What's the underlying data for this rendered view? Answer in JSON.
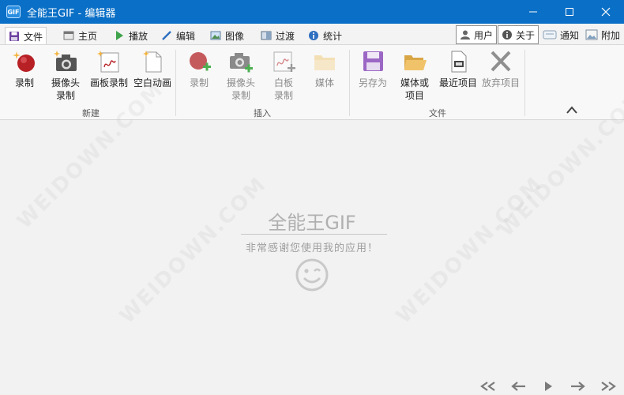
{
  "window": {
    "app_icon_text": "GIF",
    "title": "全能王GIF - 编辑器"
  },
  "tabs": [
    {
      "label": "文件",
      "icon": "save-icon",
      "active": true
    },
    {
      "label": "主页",
      "icon": "home-icon"
    },
    {
      "label": "播放",
      "icon": "play-icon"
    },
    {
      "label": "编辑",
      "icon": "pencil-icon"
    },
    {
      "label": "图像",
      "icon": "image-icon"
    },
    {
      "label": "过渡",
      "icon": "transition-icon"
    },
    {
      "label": "统计",
      "icon": "info-icon"
    }
  ],
  "right_buttons": {
    "user": "用户",
    "about": "关于",
    "notify": "通知",
    "attach": "附加"
  },
  "ribbon": {
    "groups": {
      "new": "新建",
      "insert": "插入",
      "file": "文件"
    },
    "new_items": [
      {
        "label": "录制",
        "icon": "record-icon"
      },
      {
        "label": "摄像头\n录制",
        "icon": "camera-icon"
      },
      {
        "label": "画板录制",
        "icon": "board-icon"
      },
      {
        "label": "空白动画",
        "icon": "blank-page-icon"
      }
    ],
    "insert_items": [
      {
        "label": "录制",
        "icon": "record-add-icon"
      },
      {
        "label": "摄像头\n录制",
        "icon": "camera-add-icon"
      },
      {
        "label": "白板\n录制",
        "icon": "board-add-icon"
      },
      {
        "label": "媒体",
        "icon": "folder-icon"
      }
    ],
    "file_items": [
      {
        "label": "另存为",
        "icon": "save-as-icon"
      },
      {
        "label": "媒体或\n项目",
        "icon": "open-folder-icon"
      },
      {
        "label": "最近项目",
        "icon": "recent-icon"
      },
      {
        "label": "放弃项目",
        "icon": "discard-icon"
      }
    ]
  },
  "canvas": {
    "title": "全能王GIF",
    "subtitle": "非常感谢您使用我的应用！",
    "watermark": "WEIDOWN.COM"
  },
  "colors": {
    "titlebar": "#0a6fc6",
    "record_red": "#b72025",
    "save_purple": "#8d55b8",
    "folder_orange": "#f0c36b"
  }
}
